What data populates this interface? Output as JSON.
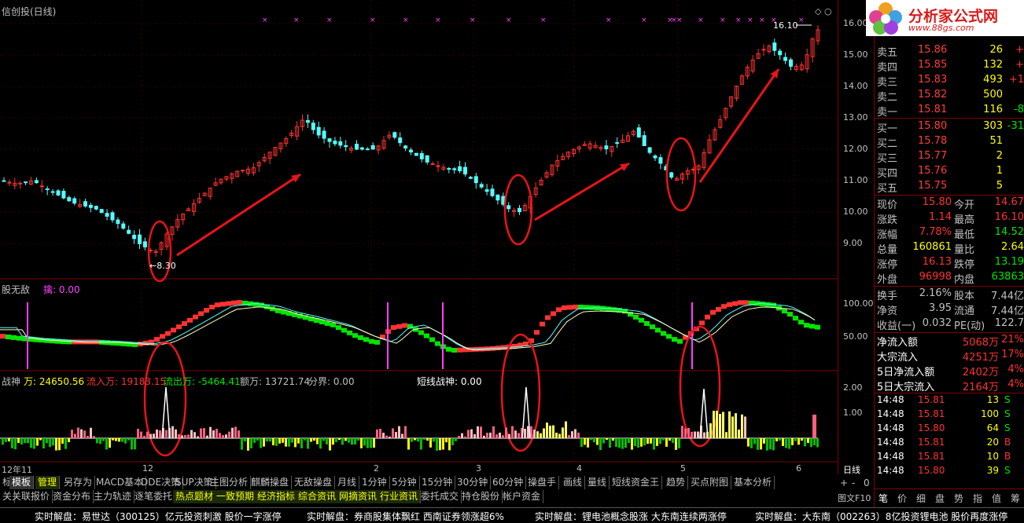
{
  "chart": {
    "title": "信创投(日线)",
    "high_label": "16.10",
    "low_label": "←8.30",
    "price_ticks": [
      "16.00",
      "15.00",
      "14.00",
      "13.00",
      "12.00",
      "11.00",
      "10.00",
      "9.00"
    ],
    "indicator1_title": "股无敌",
    "indicator1_value": "擒: 0.00",
    "indicator1_ticks": [
      "100.00",
      "50.00"
    ],
    "indicator2_title": "战神",
    "indicator2_values": {
      "wan": "万: 24650.56",
      "inflow": "流入万: 19183.15",
      "outflow": "流出万: -5464.41",
      "amount": "额万: 13721.74",
      "boundary": "分界: 0.00",
      "short": "短线战神: 0.00"
    },
    "indicator2_ticks": [
      "2.00",
      "1.00"
    ],
    "date_labels": [
      "12年11",
      "12",
      "2",
      "3",
      "4",
      "5",
      "6"
    ],
    "period_label": "日线",
    "zoom_buttons": [
      "+",
      "-",
      "0"
    ]
  },
  "colors": {
    "up": "#ff3232",
    "down": "#54ffff",
    "grid": "#800000",
    "arrow": "#e8141b",
    "ellipse": "#e8141b",
    "yellow": "#ffff00",
    "green": "#00e600"
  },
  "logo": {
    "text": "分析家公式网",
    "url": "www.88gs.com"
  },
  "order_book": {
    "asks": [
      {
        "label": "卖五",
        "price": "15.86",
        "vol": "26",
        "chg": "+"
      },
      {
        "label": "卖四",
        "price": "15.85",
        "vol": "132",
        "chg": "+"
      },
      {
        "label": "卖三",
        "price": "15.83",
        "vol": "493",
        "chg": "+1"
      },
      {
        "label": "卖二",
        "price": "15.82",
        "vol": "500",
        "chg": ""
      },
      {
        "label": "卖一",
        "price": "15.81",
        "vol": "116",
        "chg": "-8"
      }
    ],
    "bids": [
      {
        "label": "买一",
        "price": "15.80",
        "vol": "303",
        "chg": "-31"
      },
      {
        "label": "买二",
        "price": "15.78",
        "vol": "51",
        "chg": ""
      },
      {
        "label": "买三",
        "price": "15.77",
        "vol": "2",
        "chg": ""
      },
      {
        "label": "买四",
        "price": "15.76",
        "vol": "1",
        "chg": ""
      },
      {
        "label": "买五",
        "price": "15.75",
        "vol": "5",
        "chg": ""
      }
    ]
  },
  "quote": [
    {
      "l1": "现价",
      "v1": "15.80",
      "l2": "今开",
      "v2": "14.67"
    },
    {
      "l1": "涨跌",
      "v1": "1.14",
      "l2": "最高",
      "v2": "16.10"
    },
    {
      "l1": "涨幅",
      "v1": "7.78%",
      "l2": "最低",
      "v2": "14.52"
    },
    {
      "l1": "总量",
      "v1": "160861",
      "l2": "量比",
      "v2": "2.64"
    },
    {
      "l1": "涨停",
      "v1": "16.13",
      "l2": "跌停",
      "v2": "13.19"
    },
    {
      "l1": "外盘",
      "v1": "96998",
      "l2": "内盘",
      "v2": "63863"
    }
  ],
  "fundamentals": [
    {
      "l1": "换手",
      "v1": "2.16%",
      "l2": "股本",
      "v2": "7.44亿"
    },
    {
      "l1": "净资",
      "v1": "3.95",
      "l2": "流通",
      "v2": "7.44亿"
    },
    {
      "l1": "收益(一)",
      "v1": "0.032",
      "l2": "PE(动)",
      "v2": "122.7"
    }
  ],
  "flows": [
    {
      "label": "净流入额",
      "value": "5068万",
      "pct": "21%"
    },
    {
      "label": "大宗流入",
      "value": "4251万",
      "pct": "17%"
    },
    {
      "label": "5日净流入额",
      "value": "2402万",
      "pct": "4%"
    },
    {
      "label": "5日大宗流入",
      "value": "2164万",
      "pct": "4%"
    }
  ],
  "ticks": [
    {
      "time": "14:48",
      "price": "15.81",
      "vol": "13",
      "side": "S"
    },
    {
      "time": "14:48",
      "price": "15.81",
      "vol": "100",
      "side": "S"
    },
    {
      "time": "14:48",
      "price": "15.80",
      "vol": "64",
      "side": "S"
    },
    {
      "time": "14:48",
      "price": "15.81",
      "vol": "20",
      "side": "B"
    },
    {
      "time": "14:48",
      "price": "15.81",
      "vol": "10",
      "side": "B"
    },
    {
      "time": "14:48",
      "price": "15.80",
      "vol": "39",
      "side": "S"
    }
  ],
  "sidebar_tabs": [
    "笔",
    "价",
    "细",
    "盘",
    "势",
    "指",
    "值",
    "筹"
  ],
  "tabs_row1": [
    "标",
    "模板",
    "管理",
    "另存为",
    "MACD基本",
    "DDE决策",
    "SUP决策",
    "主图分析",
    "麒麟操盘",
    "无敌操盘",
    "月线",
    "1分钟",
    "5分钟",
    "15分钟",
    "30分钟",
    "60分钟",
    "操盘手",
    "画线",
    "量线",
    "短线资金王",
    "趋势",
    "买点附图",
    "基本分析"
  ],
  "tabs_row2": [
    "关",
    "关联报价",
    "资金分布",
    "主力轨迹",
    "逐笔委托",
    "热点题材",
    "一致预期",
    "经济指标",
    "综合资讯",
    "网摘资讯",
    "行业资讯",
    "委托成交",
    "持仓股份",
    "帐户资金"
  ],
  "tab_right": "图文F10",
  "ticker": [
    "实时解盘：易世达（300125）亿元投资刺激 股价一字涨停",
    "实时解盘：券商股集体飘红 西南证券领涨超6%",
    "实时解盘：锂电池概念股涨 大东南连续两涨停",
    "实时解盘：大东南（002263）8亿投资锂电池 股价再度涨停"
  ]
}
